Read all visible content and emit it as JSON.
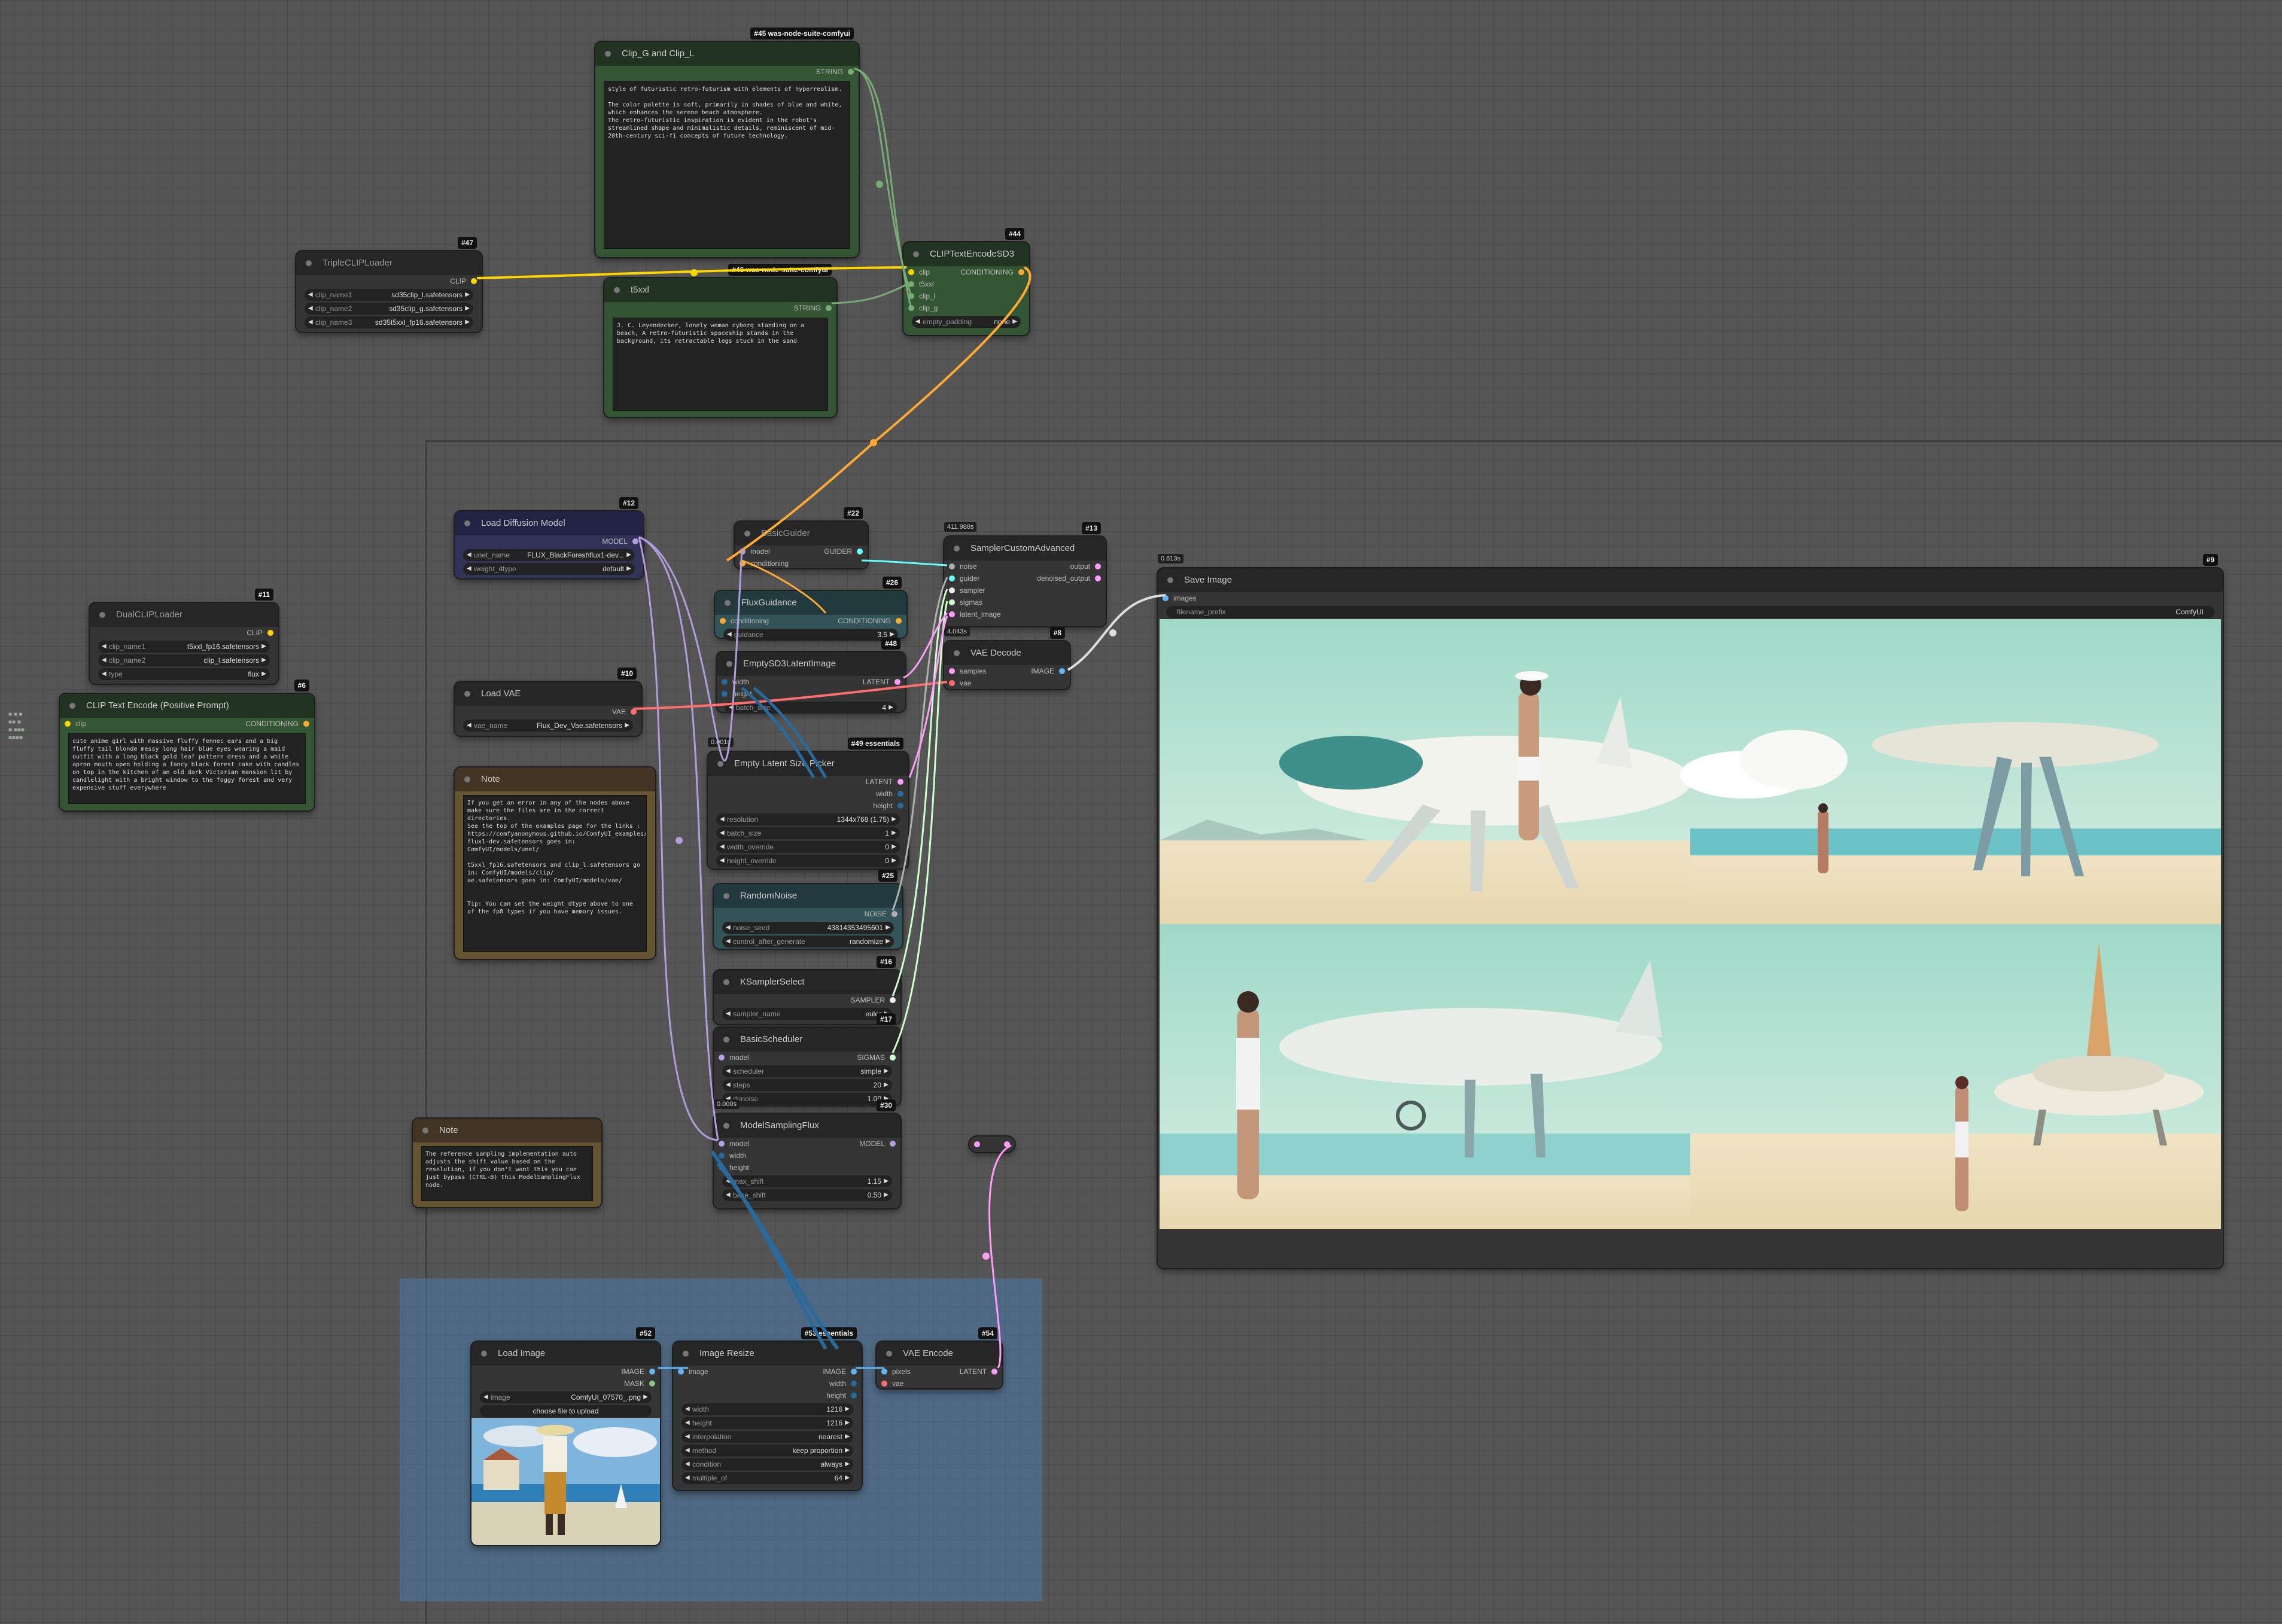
{
  "colors": {
    "clip": "#ffd500",
    "conditioning": "#ffa931",
    "model": "#b39ddb",
    "vae": "#ff6e6e",
    "latent": "#ff9cf9",
    "string": "#77aa77",
    "image": "#64b5f6",
    "noise": "#b0b0b0",
    "guider": "#66ffff",
    "sigmas": "#cdffcd",
    "mask": "#81c784",
    "int": "#29699c"
  },
  "nodes": {
    "clip_g_l": {
      "title": "Clip_G and Clip_L",
      "badge": "#45 was-node-suite-comfyui",
      "out": "STRING",
      "text": "style of futuristic retro-futurism with elements of hyperrealism.\n\nThe color palette is soft, primarily in shades of blue and white, which enhances the serene beach atmosphere.\nThe retro-futuristic inspiration is evident in the robot's streamlined shape and minimalistic details, reminiscent of mid-20th-century sci-fi concepts of future technology."
    },
    "triple_clip": {
      "title": "TripleCLIPLoader",
      "badge": "#47",
      "out": "CLIP",
      "widgets": [
        {
          "label": "clip_name1",
          "value": "sd35clip_l.safetensors"
        },
        {
          "label": "clip_name2",
          "value": "sd35clip_g.safetensors"
        },
        {
          "label": "clip_name3",
          "value": "sd35t5xxl_fp16.safetensors"
        }
      ]
    },
    "t5xxl": {
      "title": "t5xxl",
      "badge": "#46 was-node-suite-comfyui",
      "out": "STRING",
      "text": "J. C. Leyendecker, lonely woman cyborg standing on a beach, A retro-futuristic spaceship stands in the background, its retractable legs stuck in the sand"
    },
    "clip_sd3": {
      "title": "CLIPTextEncodeSD3",
      "badge": "#44",
      "inputs": [
        "clip",
        "t5xxl",
        "clip_l",
        "clip_g"
      ],
      "out": "CONDITIONING",
      "widget": {
        "label": "empty_padding",
        "value": "none"
      }
    },
    "dual_clip": {
      "title": "DualCLIPLoader",
      "badge": "#11",
      "out": "CLIP",
      "widgets": [
        {
          "label": "clip_name1",
          "value": "t5xxl_fp16.safetensors"
        },
        {
          "label": "clip_name2",
          "value": "clip_l.safetensors"
        },
        {
          "label": "type",
          "value": "flux"
        }
      ]
    },
    "clip_pos": {
      "title": "CLIP Text Encode (Positive Prompt)",
      "badge": "#6",
      "in": "clip",
      "out": "CONDITIONING",
      "text": "cute anime girl with massive fluffy fennec ears and a big fluffy tail blonde messy long hair blue eyes wearing a maid outfit with a long black gold leaf pattern dress and a white apron mouth open holding a fancy black forest cake with candles on top in the kitchen of an old dark Victorian mansion lit by candlelight with a bright window to the foggy forest and very expensive stuff everywhere"
    },
    "load_diffusion": {
      "title": "Load Diffusion Model",
      "badge": "#12",
      "out": "MODEL",
      "widgets": [
        {
          "label": "unet_name",
          "value": "FLUX_BlackForest\\flux1-dev..."
        },
        {
          "label": "weight_dtype",
          "value": "default"
        }
      ]
    },
    "load_vae": {
      "title": "Load VAE",
      "badge": "#10",
      "out": "VAE",
      "widgets": [
        {
          "label": "vae_name",
          "value": "Flux_Dev_Vae.safetensors"
        }
      ]
    },
    "note1": {
      "title": "Note",
      "text": "If you get an error in any of the nodes above make sure the files are in the correct directories.\nSee the top of the examples page for the links : https://comfyanonymous.github.io/ComfyUI_examples/flux/\nflux1-dev.safetensors goes in: ComfyUI/models/unet/\n\nt5xxl_fp16.safetensors and clip_l.safetensors go in: ComfyUI/models/clip/\nae.safetensors goes in: ComfyUI/models/vae/\n\n\nTip: You can set the weight_dtype above to one of the fp8 types if you have memory issues."
    },
    "note2": {
      "title": "Note",
      "text": "The reference sampling implementation auto adjusts the shift value based on the resolution, if you don't want this you can just bypass (CTRL-B) this ModelSamplingFlux node."
    },
    "basic_guider": {
      "title": "BasicGuider",
      "badge": "#22",
      "inputs": [
        "model",
        "conditioning"
      ],
      "out": "GUIDER"
    },
    "flux_guidance": {
      "title": "FluxGuidance",
      "badge": "#26",
      "in": "conditioning",
      "out": "CONDITIONING",
      "widgets": [
        {
          "label": "guidance",
          "value": "3.5"
        }
      ]
    },
    "empty_sd3": {
      "title": "EmptySD3LatentImage",
      "badge": "#48",
      "inputs": [
        "width",
        "height"
      ],
      "out": "LATENT",
      "widgets": [
        {
          "label": "batch_size",
          "value": "4"
        }
      ]
    },
    "latent_picker": {
      "title": "Empty Latent Size Picker",
      "badge": "#49 essentials",
      "timing": "0.001s",
      "outs": [
        "LATENT",
        "width",
        "height"
      ],
      "widgets": [
        {
          "label": "resolution",
          "value": "1344x768 (1.75)"
        },
        {
          "label": "batch_size",
          "value": "1"
        },
        {
          "label": "width_override",
          "value": "0"
        },
        {
          "label": "height_override",
          "value": "0"
        }
      ]
    },
    "random_noise": {
      "title": "RandomNoise",
      "badge": "#25",
      "out": "NOISE",
      "widgets": [
        {
          "label": "noise_seed",
          "value": "43814353495601"
        },
        {
          "label": "control_after_generate",
          "value": "randomize"
        }
      ]
    },
    "ksampler_select": {
      "title": "KSamplerSelect",
      "badge": "#16",
      "out": "SAMPLER",
      "widgets": [
        {
          "label": "sampler_name",
          "value": "euler"
        }
      ]
    },
    "basic_scheduler": {
      "title": "BasicScheduler",
      "badge": "#17",
      "in": "model",
      "out": "SIGMAS",
      "widgets": [
        {
          "label": "scheduler",
          "value": "simple"
        },
        {
          "label": "steps",
          "value": "20"
        },
        {
          "label": "denoise",
          "value": "1.00"
        }
      ]
    },
    "model_sampling": {
      "title": "ModelSamplingFlux",
      "badge": "#30",
      "timing": "0.000s",
      "inputs": [
        "model",
        "width",
        "height"
      ],
      "out": "MODEL",
      "widgets": [
        {
          "label": "max_shift",
          "value": "1.15"
        },
        {
          "label": "base_shift",
          "value": "0.50"
        }
      ]
    },
    "sampler_custom": {
      "title": "SamplerCustomAdvanced",
      "badge": "#13",
      "timing": "411.988s",
      "inputs": [
        "noise",
        "guider",
        "sampler",
        "sigmas",
        "latent_image"
      ],
      "outs": [
        "output",
        "denoised_output"
      ]
    },
    "vae_decode": {
      "title": "VAE Decode",
      "badge": "#8",
      "timing": "4.043s",
      "inputs": [
        "samples",
        "vae"
      ],
      "out": "IMAGE"
    },
    "save_image": {
      "title": "Save Image",
      "badge": "#9",
      "timing": "0.613s",
      "in": "images",
      "widget": {
        "label": "filename_prefix",
        "value": "ComfyUI"
      }
    },
    "load_image": {
      "title": "Load Image",
      "badge": "#52",
      "outs": [
        "IMAGE",
        "MASK"
      ],
      "widgets": [
        {
          "label": "image",
          "value": "ComfyUI_07570_.png"
        }
      ],
      "upload": "choose file to upload"
    },
    "image_resize": {
      "title": "Image Resize",
      "badge": "#53 essentials",
      "in": "image",
      "outs": [
        "IMAGE",
        "width",
        "height"
      ],
      "widgets": [
        {
          "label": "width",
          "value": "1216"
        },
        {
          "label": "height",
          "value": "1216"
        },
        {
          "label": "interpolation",
          "value": "nearest"
        },
        {
          "label": "method",
          "value": "keep proportion"
        },
        {
          "label": "condition",
          "value": "always"
        },
        {
          "label": "multiple_of",
          "value": "64"
        }
      ]
    },
    "vae_encode": {
      "title": "VAE Encode",
      "badge": "#54",
      "inputs": [
        "pixels",
        "vae"
      ],
      "out": "LATENT"
    }
  }
}
